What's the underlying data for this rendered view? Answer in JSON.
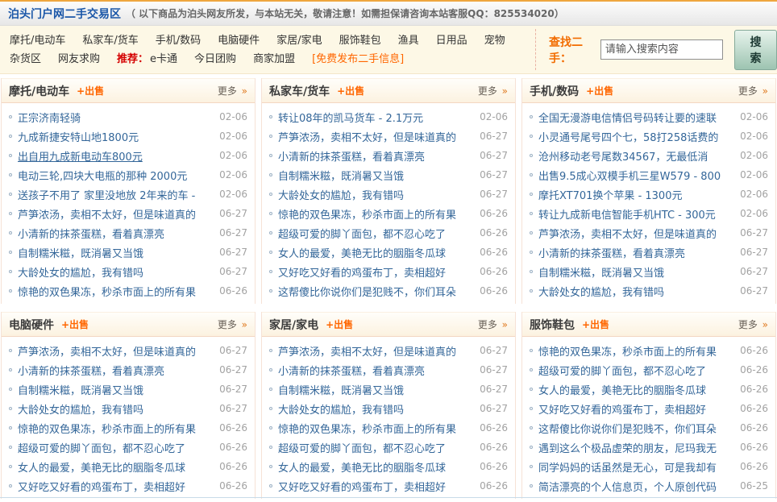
{
  "colors": {
    "accent_orange": "#ff6600",
    "link_blue": "#336699",
    "title_blue": "#1b57a8",
    "recommend_red": "#d40000",
    "date_gray": "#a2a2a2",
    "topbar_border_orange": "#efa63f",
    "nav_cream_bg": "#fdf8e6",
    "search_button_green": "#9dc4b1"
  },
  "header": {
    "title": "泊头门户网二手交易区",
    "notice": "（ 以下商品为泊头网友所发，与本站无关，敬请注意！如需担保请咨询本站客服QQ：825534020）"
  },
  "nav": {
    "row1": [
      "摩托/电动车",
      "私家车/货车",
      "手机/数码",
      "电脑硬件",
      "家居/家电",
      "服饰鞋包",
      "渔具",
      "日用品",
      "宠物"
    ],
    "row2": [
      "杂货区",
      "网友求购"
    ],
    "recommend_label": "推荐：",
    "recommend_links": [
      "e卡通",
      "今日团购",
      "商家加盟"
    ],
    "free_post_link": "[免费发布二手信息]"
  },
  "search": {
    "label": "查找二手：",
    "placeholder": "请输入搜索内容",
    "button_label": "搜 索"
  },
  "panel_ui": {
    "sell_label": "+出售",
    "more_label": "更多",
    "more_arrow": "»"
  },
  "panels": [
    {
      "title": "摩托/电动车",
      "items": [
        {
          "text": "正宗济南轻骑",
          "date": "02-06"
        },
        {
          "text": "九成新捷安特山地1800元",
          "date": "02-06"
        },
        {
          "text": "出自用九成新电动车800元",
          "date": "02-06",
          "underline": true
        },
        {
          "text": "电动三轮,四块大电瓶的那种 2000元",
          "date": "02-06"
        },
        {
          "text": "送孩子不用了 家里没地放 2年来的车 -",
          "date": "02-06"
        },
        {
          "text": "芦笋浓汤，卖相不太好，但是味道真的",
          "date": "06-27"
        },
        {
          "text": "小清新的抹茶蛋糕，看着真漂亮",
          "date": "06-27"
        },
        {
          "text": "自制糯米糍，既消暑又当饿",
          "date": "06-27"
        },
        {
          "text": "大龄处女的尴尬，我有错吗",
          "date": "06-27"
        },
        {
          "text": "惊艳的双色果冻，秒杀市面上的所有果",
          "date": "06-26"
        }
      ]
    },
    {
      "title": "私家车/货车",
      "items": [
        {
          "text": "转让08年的凯马货车 - 2.1万元",
          "date": "02-06"
        },
        {
          "text": "芦笋浓汤，卖相不太好，但是味道真的",
          "date": "06-27"
        },
        {
          "text": "小清新的抹茶蛋糕，看着真漂亮",
          "date": "06-27"
        },
        {
          "text": "自制糯米糍，既消暑又当饿",
          "date": "06-27"
        },
        {
          "text": "大龄处女的尴尬，我有错吗",
          "date": "06-27"
        },
        {
          "text": "惊艳的双色果冻，秒杀市面上的所有果",
          "date": "06-26"
        },
        {
          "text": "超级可爱的脚丫面包，都不忍心吃了",
          "date": "06-26"
        },
        {
          "text": "女人的最爱，美艳无比的胭脂冬瓜球",
          "date": "06-26"
        },
        {
          "text": "又好吃又好看的鸡蛋布丁，卖相超好",
          "date": "06-26"
        },
        {
          "text": "这帮傻比你说你们是犯贱不，你们耳朵",
          "date": "06-26"
        }
      ]
    },
    {
      "title": "手机/数码",
      "items": [
        {
          "text": "全国无漫游电信情侣号码转让要的速联",
          "date": "02-06"
        },
        {
          "text": "小灵通号尾号四个七，58打258话费的",
          "date": "02-06"
        },
        {
          "text": "沧州移动老号尾数34567，无最低消",
          "date": "02-06"
        },
        {
          "text": "出售9.5成心双模手机三星W579 - 800",
          "date": "02-06"
        },
        {
          "text": "摩托XT701换个苹果 - 1300元",
          "date": "02-06"
        },
        {
          "text": "转让九成新电信智能手机HTC - 300元",
          "date": "02-06"
        },
        {
          "text": "芦笋浓汤，卖相不太好，但是味道真的",
          "date": "06-27"
        },
        {
          "text": "小清新的抹茶蛋糕，看着真漂亮",
          "date": "06-27"
        },
        {
          "text": "自制糯米糍，既消暑又当饿",
          "date": "06-27"
        },
        {
          "text": "大龄处女的尴尬，我有错吗",
          "date": "06-27"
        }
      ]
    },
    {
      "title": "电脑硬件",
      "items": [
        {
          "text": "芦笋浓汤，卖相不太好，但是味道真的",
          "date": "06-27"
        },
        {
          "text": "小清新的抹茶蛋糕，看着真漂亮",
          "date": "06-27"
        },
        {
          "text": "自制糯米糍，既消暑又当饿",
          "date": "06-27"
        },
        {
          "text": "大龄处女的尴尬，我有错吗",
          "date": "06-27"
        },
        {
          "text": "惊艳的双色果冻，秒杀市面上的所有果",
          "date": "06-26"
        },
        {
          "text": "超级可爱的脚丫面包，都不忍心吃了",
          "date": "06-26"
        },
        {
          "text": "女人的最爱，美艳无比的胭脂冬瓜球",
          "date": "06-26"
        },
        {
          "text": "又好吃又好看的鸡蛋布丁，卖相超好",
          "date": "06-26"
        }
      ]
    },
    {
      "title": "家居/家电",
      "items": [
        {
          "text": "芦笋浓汤，卖相不太好，但是味道真的",
          "date": "06-27"
        },
        {
          "text": "小清新的抹茶蛋糕，看着真漂亮",
          "date": "06-27"
        },
        {
          "text": "自制糯米糍，既消暑又当饿",
          "date": "06-27"
        },
        {
          "text": "大龄处女的尴尬，我有错吗",
          "date": "06-27"
        },
        {
          "text": "惊艳的双色果冻，秒杀市面上的所有果",
          "date": "06-26"
        },
        {
          "text": "超级可爱的脚丫面包，都不忍心吃了",
          "date": "06-26"
        },
        {
          "text": "女人的最爱，美艳无比的胭脂冬瓜球",
          "date": "06-26"
        },
        {
          "text": "又好吃又好看的鸡蛋布丁，卖相超好",
          "date": "06-26"
        }
      ]
    },
    {
      "title": "服饰鞋包",
      "items": [
        {
          "text": "惊艳的双色果冻，秒杀市面上的所有果",
          "date": "06-26"
        },
        {
          "text": "超级可爱的脚丫面包，都不忍心吃了",
          "date": "06-26"
        },
        {
          "text": "女人的最爱，美艳无比的胭脂冬瓜球",
          "date": "06-26"
        },
        {
          "text": "又好吃又好看的鸡蛋布丁，卖相超好",
          "date": "06-26"
        },
        {
          "text": "这帮傻比你说你们是犯贱不，你们耳朵",
          "date": "06-26"
        },
        {
          "text": "遇到这么个极品虚荣的朋友，尼玛我无",
          "date": "06-26"
        },
        {
          "text": "同学妈妈的话虽然是无心，可是我却有",
          "date": "06-26"
        },
        {
          "text": "简洁漂亮的个人信息页，个人原创代码",
          "date": "06-25"
        }
      ]
    }
  ]
}
